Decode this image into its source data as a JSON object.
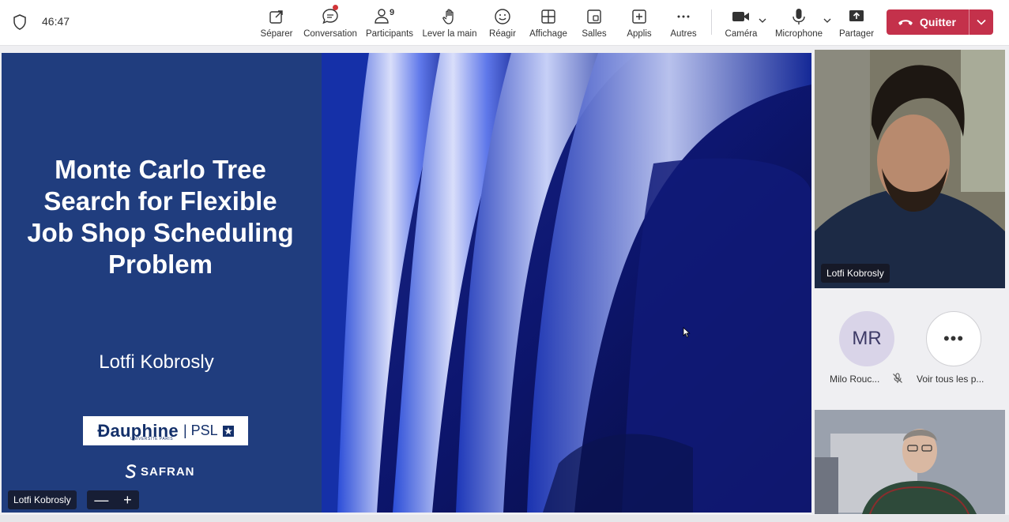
{
  "meeting": {
    "timer": "46:47"
  },
  "toolbar": {
    "separer": "Séparer",
    "conversation": "Conversation",
    "participants": "Participants",
    "participants_count": "9",
    "lever_main": "Lever la main",
    "reagir": "Réagir",
    "affichage": "Affichage",
    "salles": "Salles",
    "applis": "Applis",
    "autres": "Autres",
    "camera": "Caméra",
    "microphone": "Microphone",
    "partager": "Partager",
    "quitter": "Quitter"
  },
  "slide": {
    "title": "Monte Carlo Tree Search for Flexible Job Shop Scheduling Problem",
    "author": "Lotfi Kobrosly",
    "logo_dauphine": "Ɖauphine",
    "logo_dauphine_sub": "UNIVERSITÉ PARIS",
    "logo_psl": "| PSL",
    "logo_safran": "SAFRAN"
  },
  "stage": {
    "presenter_tag": "Lotfi Kobrosly",
    "zoom_out": "—",
    "zoom_in": "+"
  },
  "participants": {
    "tile1_name": "Lotfi Kobrosly",
    "avatar_initials": "MR",
    "avatar_name": "Milo Rouc...",
    "more_icon": "•••",
    "more_label": "Voir tous les p..."
  },
  "colors": {
    "quit_red": "#c4314b",
    "slide_blue": "#203d7e"
  }
}
